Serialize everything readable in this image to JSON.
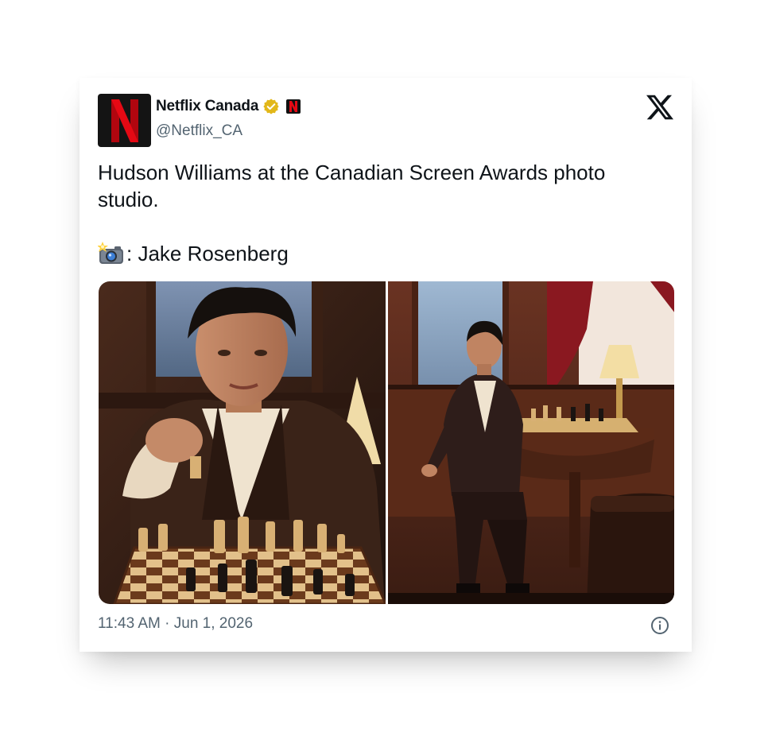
{
  "account": {
    "display_name": "Netflix Canada",
    "handle": "@Netflix_CA",
    "avatar_letter": "N",
    "affiliate_letter": "N",
    "verified": true,
    "brand_red": "#E50914",
    "verified_gold": "#E2B719"
  },
  "tweet": {
    "text": "Hudson Williams at the Canadian Screen Awards photo studio.",
    "credit_text": ": Jake Rosenberg",
    "credit_icon": "camera-with-flash-icon",
    "timestamp": "11:43 AM · Jun 1, 2026"
  },
  "media": {
    "photos": [
      {
        "id": "photo-1",
        "icon": "photo-portrait-chess-closeup"
      },
      {
        "id": "photo-2",
        "icon": "photo-seated-chess-table"
      }
    ]
  },
  "icons": {
    "platform": "x-logo-icon",
    "info": "info-icon"
  }
}
